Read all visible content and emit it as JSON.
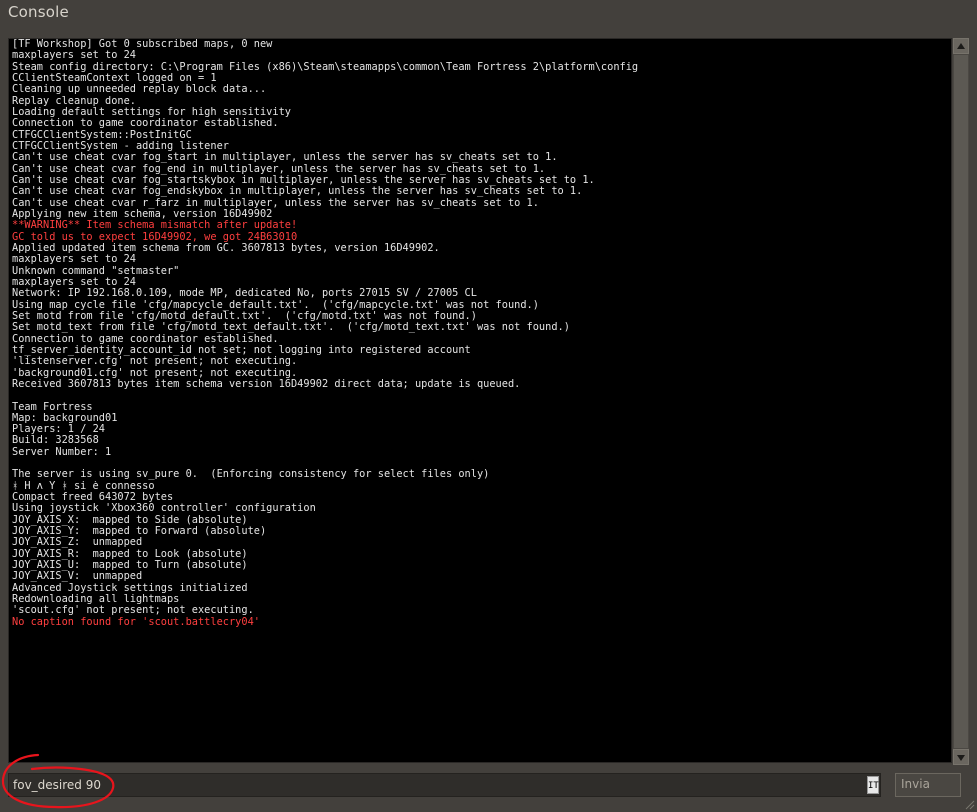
{
  "window": {
    "title": "Console"
  },
  "console": {
    "lines": [
      {
        "text": "[TF Workshop] Got 0 subscribed maps, 0 new",
        "level": "info"
      },
      {
        "text": "maxplayers set to 24",
        "level": "info"
      },
      {
        "text": "Steam config directory: C:\\Program Files (x86)\\Steam\\steamapps\\common\\Team Fortress 2\\platform\\config",
        "level": "info"
      },
      {
        "text": "CClientSteamContext logged on = 1",
        "level": "info"
      },
      {
        "text": "Cleaning up unneeded replay block data...",
        "level": "info"
      },
      {
        "text": "Replay cleanup done.",
        "level": "info"
      },
      {
        "text": "Loading default settings for high sensitivity",
        "level": "info"
      },
      {
        "text": "Connection to game coordinator established.",
        "level": "info"
      },
      {
        "text": "CTFGCClientSystem::PostInitGC",
        "level": "info"
      },
      {
        "text": "CTFGCClientSystem - adding listener",
        "level": "info"
      },
      {
        "text": "Can't use cheat cvar fog_start in multiplayer, unless the server has sv_cheats set to 1.",
        "level": "info"
      },
      {
        "text": "Can't use cheat cvar fog_end in multiplayer, unless the server has sv_cheats set to 1.",
        "level": "info"
      },
      {
        "text": "Can't use cheat cvar fog_startskybox in multiplayer, unless the server has sv_cheats set to 1.",
        "level": "info"
      },
      {
        "text": "Can't use cheat cvar fog_endskybox in multiplayer, unless the server has sv_cheats set to 1.",
        "level": "info"
      },
      {
        "text": "Can't use cheat cvar r_farz in multiplayer, unless the server has sv_cheats set to 1.",
        "level": "info"
      },
      {
        "text": "Applying new item schema, version 16D49902",
        "level": "info"
      },
      {
        "text": "**WARNING** Item schema mismatch after update!",
        "level": "warn"
      },
      {
        "text": "GC told us to expect 16D49902, we got 24B63010",
        "level": "warn"
      },
      {
        "text": "Applied updated item schema from GC. 3607813 bytes, version 16D49902.",
        "level": "info"
      },
      {
        "text": "maxplayers set to 24",
        "level": "info"
      },
      {
        "text": "Unknown command \"setmaster\"",
        "level": "info"
      },
      {
        "text": "maxplayers set to 24",
        "level": "info"
      },
      {
        "text": "Network: IP 192.168.0.109, mode MP, dedicated No, ports 27015 SV / 27005 CL",
        "level": "info"
      },
      {
        "text": "Using map cycle file 'cfg/mapcycle_default.txt'.  ('cfg/mapcycle.txt' was not found.)",
        "level": "info"
      },
      {
        "text": "Set motd from file 'cfg/motd_default.txt'.  ('cfg/motd.txt' was not found.)",
        "level": "info"
      },
      {
        "text": "Set motd_text from file 'cfg/motd_text_default.txt'.  ('cfg/motd_text.txt' was not found.)",
        "level": "info"
      },
      {
        "text": "Connection to game coordinator established.",
        "level": "info"
      },
      {
        "text": "tf_server_identity_account_id not set; not logging into registered account",
        "level": "info"
      },
      {
        "text": "'listenserver.cfg' not present; not executing.",
        "level": "info"
      },
      {
        "text": "'background01.cfg' not present; not executing.",
        "level": "info"
      },
      {
        "text": "Received 3607813 bytes item schema version 16D49902 direct data; update is queued.",
        "level": "info"
      },
      {
        "text": "",
        "level": "info"
      },
      {
        "text": "Team Fortress",
        "level": "info"
      },
      {
        "text": "Map: background01",
        "level": "info"
      },
      {
        "text": "Players: 1 / 24",
        "level": "info"
      },
      {
        "text": "Build: 3283568",
        "level": "info"
      },
      {
        "text": "Server Number: 1",
        "level": "info"
      },
      {
        "text": "",
        "level": "info"
      },
      {
        "text": "The server is using sv_pure 0.  (Enforcing consistency for select files only)",
        "level": "info"
      },
      {
        "text": "ᚼ H ʌ Y ᚼ si è connesso",
        "level": "info"
      },
      {
        "text": "Compact freed 643072 bytes",
        "level": "info"
      },
      {
        "text": "Using joystick 'Xbox360 controller' configuration",
        "level": "info"
      },
      {
        "text": "JOY_AXIS_X:  mapped to Side (absolute)",
        "level": "info"
      },
      {
        "text": "JOY_AXIS_Y:  mapped to Forward (absolute)",
        "level": "info"
      },
      {
        "text": "JOY_AXIS_Z:  unmapped",
        "level": "info"
      },
      {
        "text": "JOY_AXIS_R:  mapped to Look (absolute)",
        "level": "info"
      },
      {
        "text": "JOY_AXIS_U:  mapped to Turn (absolute)",
        "level": "info"
      },
      {
        "text": "JOY_AXIS_V:  unmapped",
        "level": "info"
      },
      {
        "text": "Advanced Joystick settings initialized",
        "level": "info"
      },
      {
        "text": "Redownloading all lightmaps",
        "level": "info"
      },
      {
        "text": "'scout.cfg' not present; not executing.",
        "level": "info"
      },
      {
        "text": "No caption found for 'scout.battlecry04'",
        "level": "warn"
      }
    ],
    "input_value": "fov_desired 90",
    "ime_indicator": "IT",
    "submit_label": "Invia"
  },
  "colors": {
    "window_bg": "#43403c",
    "log_bg": "#000000",
    "log_text": "#e4e4e4",
    "warning_text": "#ff3f3f",
    "annotation_circle": "#e8141c"
  },
  "icons": {
    "scroll_up": "triangle-up-icon",
    "scroll_down": "triangle-down-icon",
    "resize": "resize-grip-icon"
  }
}
